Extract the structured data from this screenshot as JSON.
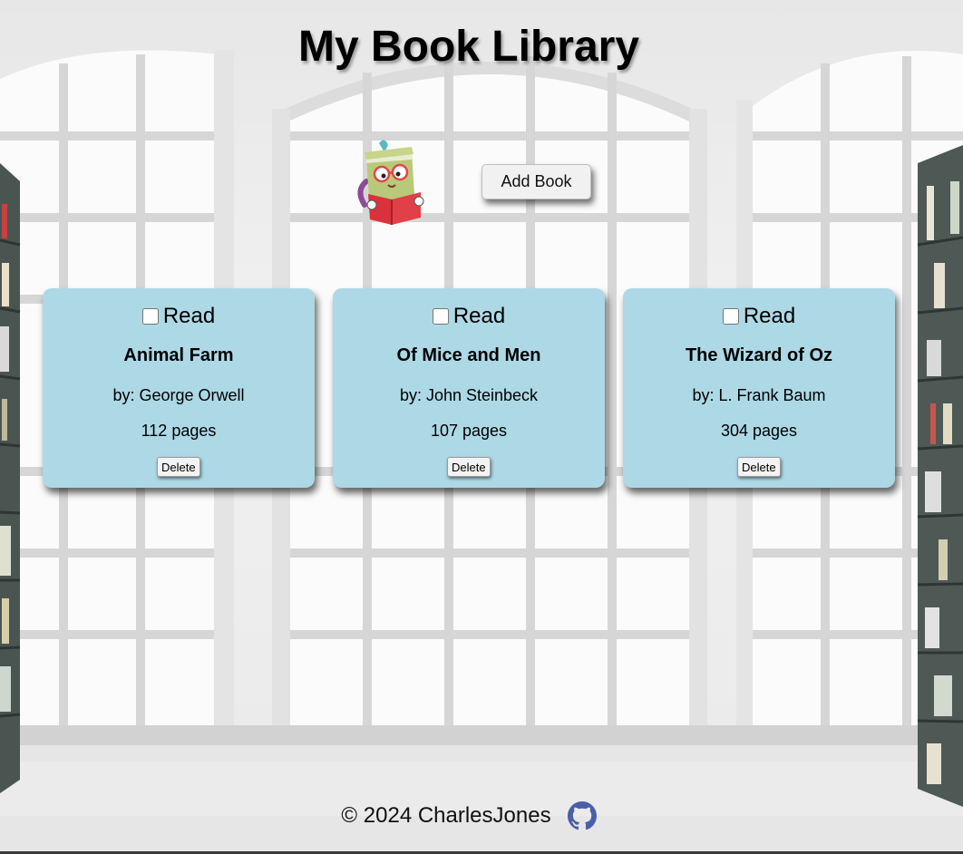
{
  "header": {
    "title": "My Book Library"
  },
  "toolbar": {
    "add_book_label": "Add Book"
  },
  "books": [
    {
      "read_label": "Read",
      "read_checked": false,
      "title": "Animal Farm",
      "author": "by: George Orwell",
      "pages": "112 pages",
      "delete_label": "Delete"
    },
    {
      "read_label": "Read",
      "read_checked": false,
      "title": "Of Mice and Men",
      "author": "by: John Steinbeck",
      "pages": "107 pages",
      "delete_label": "Delete"
    },
    {
      "read_label": "Read",
      "read_checked": false,
      "title": "The Wizard of Oz",
      "author": "by: L. Frank Baum",
      "pages": "304 pages",
      "delete_label": "Delete"
    }
  ],
  "footer": {
    "copyright": "© 2024 CharlesJones",
    "icon": "github-icon"
  },
  "colors": {
    "card_background": "#add8e6",
    "page_background": "#eeeeee",
    "github_icon": "#4a5fa8"
  }
}
